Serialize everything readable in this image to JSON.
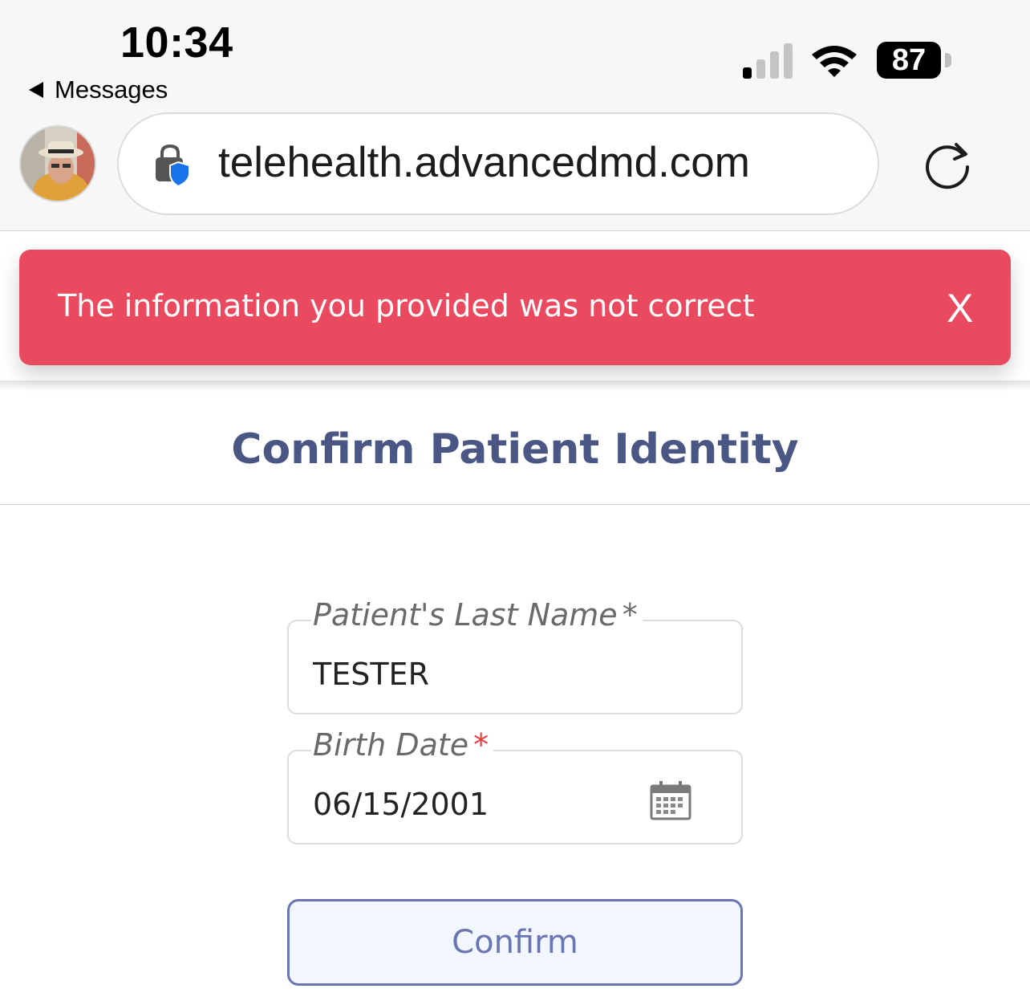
{
  "status_bar": {
    "time": "10:34",
    "back_label": "Messages",
    "battery": "87"
  },
  "browser": {
    "url": "telehealth.advancedmd.com"
  },
  "toast": {
    "message": "The information you provided was not correct",
    "close_label": "X",
    "color": "#ea4a5f"
  },
  "page": {
    "title": "Confirm Patient Identity",
    "last_name_field": {
      "label": "Patient's Last Name",
      "required_mark": "*",
      "value": "TESTER"
    },
    "birth_date_field": {
      "label": "Birth Date",
      "required_mark": "*",
      "value": "06/15/2001"
    },
    "confirm_label": "Confirm"
  },
  "colors": {
    "title": "#4a5683",
    "button_accent": "#6a76b4",
    "required_red": "#e83b3b"
  }
}
